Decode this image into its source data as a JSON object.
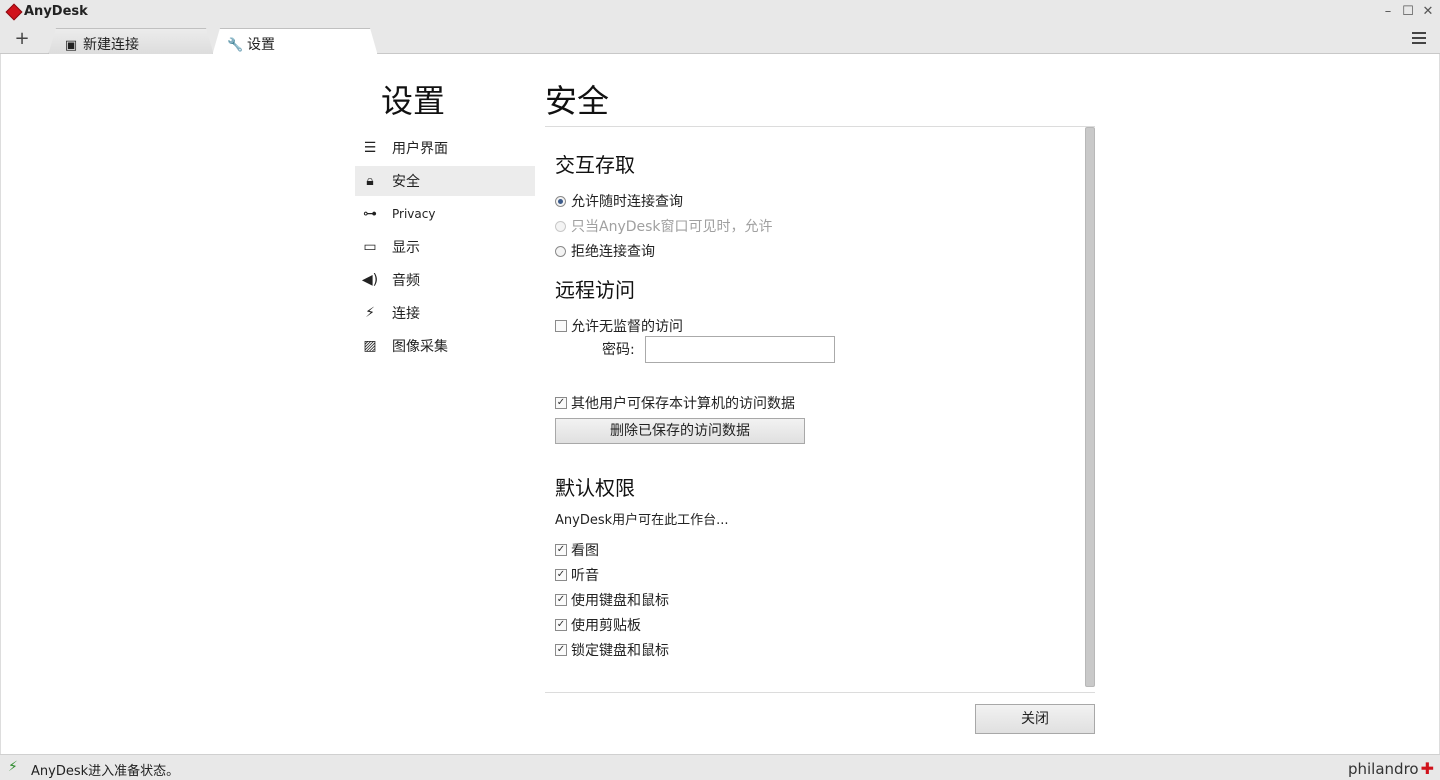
{
  "app": {
    "title": "AnyDesk"
  },
  "window": {
    "minimize": "–",
    "maximize": "☐",
    "close": "✕"
  },
  "tabs": {
    "add": "+",
    "items": [
      {
        "label": "新建连接"
      },
      {
        "label": "设置"
      }
    ]
  },
  "sidebar": {
    "title": "设置",
    "items": [
      {
        "label": "用户界面"
      },
      {
        "label": "安全"
      },
      {
        "label": "Privacy"
      },
      {
        "label": "显示"
      },
      {
        "label": "音频"
      },
      {
        "label": "连接"
      },
      {
        "label": "图像采集"
      }
    ]
  },
  "main": {
    "title": "安全",
    "interactive_access": {
      "heading": "交互存取",
      "options": [
        "允许随时连接查询",
        "只当AnyDesk窗口可见时，允许",
        "拒绝连接查询"
      ],
      "selected": "允许随时连接查询"
    },
    "remote_access": {
      "heading": "远程访问",
      "unattended_label": "允许无监督的访问",
      "unattended_checked": false,
      "password_label": "密码:",
      "password_value": "",
      "save_access_label": "其他用户可保存本计算机的访问数据",
      "save_access_checked": true,
      "delete_button": "删除已保存的访问数据"
    },
    "default_permissions": {
      "heading": "默认权限",
      "description": "AnyDesk用户可在此工作台...",
      "items": [
        {
          "label": "看图",
          "checked": true
        },
        {
          "label": "听音",
          "checked": true
        },
        {
          "label": "使用键盘和鼠标",
          "checked": true
        },
        {
          "label": "使用剪贴板",
          "checked": true
        },
        {
          "label": "锁定键盘和鼠标",
          "checked": true
        }
      ]
    },
    "close_button": "关闭"
  },
  "status": {
    "text": "AnyDesk进入准备状态。",
    "brand": "philandro"
  },
  "colors": {
    "accent": "#d0121b",
    "status_ok": "#2e8b2e"
  }
}
